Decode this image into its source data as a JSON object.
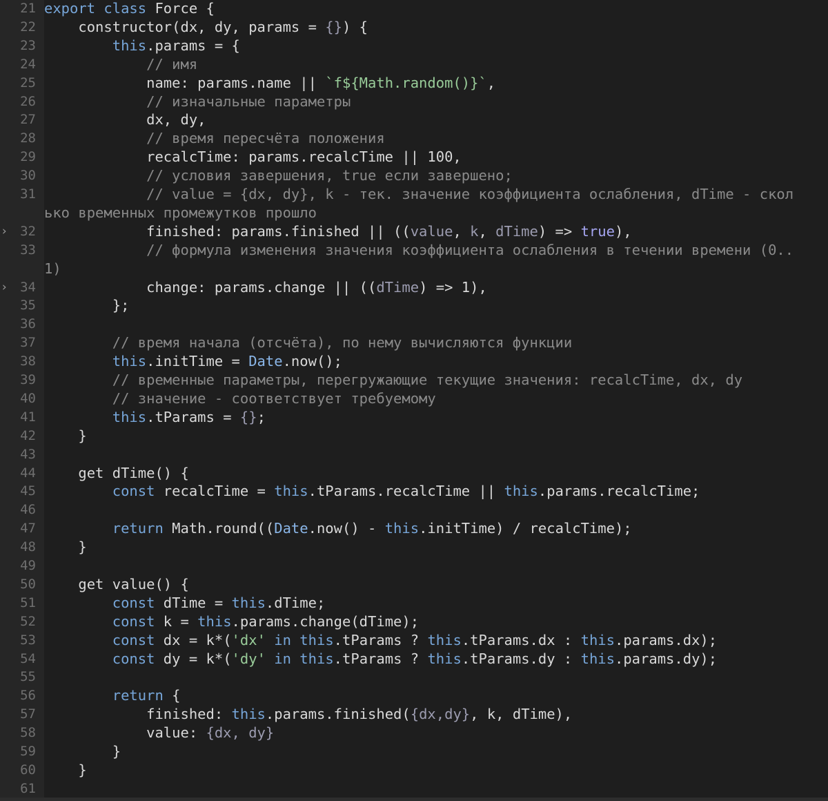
{
  "editor": {
    "theme_colors": {
      "background": "#1e1e1e",
      "gutter": "#262626",
      "comment": "#8a8a8a",
      "keyword": "#77a6d9",
      "string": "#99cc99",
      "text": "#d9d9d9"
    },
    "lines": [
      {
        "num": "21",
        "tokens": [
          [
            "kw",
            "export class "
          ],
          [
            "pl",
            "Force {"
          ]
        ]
      },
      {
        "num": "22",
        "tokens": [
          [
            "pl",
            "    constructor(dx, dy, params = "
          ],
          [
            "pr",
            "{}"
          ],
          [
            "pl",
            ") {"
          ]
        ]
      },
      {
        "num": "23",
        "tokens": [
          [
            "kw",
            "        this"
          ],
          [
            "pl",
            ".params = {"
          ]
        ]
      },
      {
        "num": "24",
        "tokens": [
          [
            "cm",
            "            // имя"
          ]
        ]
      },
      {
        "num": "25",
        "tokens": [
          [
            "pl",
            "            name: params.name || "
          ],
          [
            "str",
            "`f${Math.random()}`"
          ],
          [
            "pl",
            ","
          ]
        ]
      },
      {
        "num": "26",
        "tokens": [
          [
            "cm",
            "            // изначальные параметры"
          ]
        ]
      },
      {
        "num": "27",
        "tokens": [
          [
            "pl",
            "            dx, dy,"
          ]
        ]
      },
      {
        "num": "28",
        "tokens": [
          [
            "cm",
            "            // время пересчёта положения"
          ]
        ]
      },
      {
        "num": "29",
        "tokens": [
          [
            "pl",
            "            recalcTime: params.recalcTime || 100,"
          ]
        ]
      },
      {
        "num": "30",
        "tokens": [
          [
            "cm",
            "            // условия завершения, true если завершено;"
          ]
        ]
      },
      {
        "num": "31",
        "tokens": [
          [
            "cm",
            "            // value = {dx, dy}, k - тек. значение коэффициента ослабления, dTime - скол"
          ]
        ]
      },
      {
        "num": "",
        "tokens": [
          [
            "cm",
            "ько временных промежутков прошло"
          ]
        ]
      },
      {
        "num": "32",
        "fold": true,
        "tokens": [
          [
            "pl",
            "            finished: params.finished || (("
          ],
          [
            "pr",
            "value"
          ],
          [
            "pl",
            ", "
          ],
          [
            "pr",
            "k"
          ],
          [
            "pl",
            ", "
          ],
          [
            "pr",
            "dTime"
          ],
          [
            "pl",
            ") => "
          ],
          [
            "pu",
            "true"
          ],
          [
            "pl",
            "),"
          ]
        ]
      },
      {
        "num": "33",
        "tokens": [
          [
            "cm",
            "            // формула изменения значения коэффициента ослабления в течении времени (0.."
          ]
        ]
      },
      {
        "num": "",
        "tokens": [
          [
            "cm",
            "1)"
          ]
        ]
      },
      {
        "num": "34",
        "fold": true,
        "tokens": [
          [
            "pl",
            "            change: params.change || (("
          ],
          [
            "pr",
            "dTime"
          ],
          [
            "pl",
            ") => 1),"
          ]
        ]
      },
      {
        "num": "35",
        "tokens": [
          [
            "pl",
            "        };"
          ]
        ]
      },
      {
        "num": "36",
        "tokens": []
      },
      {
        "num": "37",
        "tokens": [
          [
            "cm",
            "        // время начала (отсчёта), по нему вычисляются функции"
          ]
        ]
      },
      {
        "num": "38",
        "tokens": [
          [
            "kw",
            "        this"
          ],
          [
            "pl",
            ".initTime = "
          ],
          [
            "ty",
            "Date"
          ],
          [
            "pl",
            ".now();"
          ]
        ]
      },
      {
        "num": "39",
        "tokens": [
          [
            "cm",
            "        // временные параметры, перегружающие текущие значения: recalcTime, dx, dy"
          ]
        ]
      },
      {
        "num": "40",
        "tokens": [
          [
            "cm",
            "        // значение - соответствует требуемому"
          ]
        ]
      },
      {
        "num": "41",
        "tokens": [
          [
            "kw",
            "        this"
          ],
          [
            "pl",
            ".tParams = "
          ],
          [
            "pr",
            "{}"
          ],
          [
            "pl",
            ";"
          ]
        ]
      },
      {
        "num": "42",
        "tokens": [
          [
            "pl",
            "    }"
          ]
        ]
      },
      {
        "num": "43",
        "tokens": []
      },
      {
        "num": "44",
        "tokens": [
          [
            "pl",
            "    get dTime() {"
          ]
        ]
      },
      {
        "num": "45",
        "tokens": [
          [
            "kw",
            "        const "
          ],
          [
            "pl",
            "recalcTime = "
          ],
          [
            "kw",
            "this"
          ],
          [
            "pl",
            ".tParams.recalcTime || "
          ],
          [
            "kw",
            "this"
          ],
          [
            "pl",
            ".params.recalcTime;"
          ]
        ]
      },
      {
        "num": "46",
        "tokens": []
      },
      {
        "num": "47",
        "tokens": [
          [
            "kw",
            "        return "
          ],
          [
            "pl",
            "Math.round(("
          ],
          [
            "ty",
            "Date"
          ],
          [
            "pl",
            ".now() - "
          ],
          [
            "kw",
            "this"
          ],
          [
            "pl",
            ".initTime) / recalcTime);"
          ]
        ]
      },
      {
        "num": "48",
        "tokens": [
          [
            "pl",
            "    }"
          ]
        ]
      },
      {
        "num": "49",
        "tokens": []
      },
      {
        "num": "50",
        "tokens": [
          [
            "pl",
            "    get value() {"
          ]
        ]
      },
      {
        "num": "51",
        "tokens": [
          [
            "kw",
            "        const "
          ],
          [
            "pl",
            "dTime = "
          ],
          [
            "kw",
            "this"
          ],
          [
            "pl",
            ".dTime;"
          ]
        ]
      },
      {
        "num": "52",
        "tokens": [
          [
            "kw",
            "        const "
          ],
          [
            "pl",
            "k = "
          ],
          [
            "kw",
            "this"
          ],
          [
            "pl",
            ".params.change(dTime);"
          ]
        ]
      },
      {
        "num": "53",
        "tokens": [
          [
            "kw",
            "        const "
          ],
          [
            "pl",
            "dx = k*("
          ],
          [
            "str",
            "'dx'"
          ],
          [
            "kw",
            " in this"
          ],
          [
            "pl",
            ".tParams ? "
          ],
          [
            "kw",
            "this"
          ],
          [
            "pl",
            ".tParams.dx : "
          ],
          [
            "kw",
            "this"
          ],
          [
            "pl",
            ".params.dx);"
          ]
        ]
      },
      {
        "num": "54",
        "tokens": [
          [
            "kw",
            "        const "
          ],
          [
            "pl",
            "dy = k*("
          ],
          [
            "str",
            "'dy'"
          ],
          [
            "kw",
            " in this"
          ],
          [
            "pl",
            ".tParams ? "
          ],
          [
            "kw",
            "this"
          ],
          [
            "pl",
            ".tParams.dy : "
          ],
          [
            "kw",
            "this"
          ],
          [
            "pl",
            ".params.dy);"
          ]
        ]
      },
      {
        "num": "55",
        "tokens": []
      },
      {
        "num": "56",
        "tokens": [
          [
            "kw",
            "        return "
          ],
          [
            "pl",
            "{"
          ]
        ]
      },
      {
        "num": "57",
        "tokens": [
          [
            "pl",
            "            finished: "
          ],
          [
            "kw",
            "this"
          ],
          [
            "pl",
            ".params.finished("
          ],
          [
            "pr",
            "{dx,dy}"
          ],
          [
            "pl",
            ", k, dTime),"
          ]
        ]
      },
      {
        "num": "58",
        "tokens": [
          [
            "pl",
            "            value: "
          ],
          [
            "pr",
            "{dx, dy}"
          ]
        ]
      },
      {
        "num": "59",
        "tokens": [
          [
            "pl",
            "        }"
          ]
        ]
      },
      {
        "num": "60",
        "tokens": [
          [
            "pl",
            "    }"
          ]
        ]
      },
      {
        "num": "61",
        "tokens": []
      }
    ]
  }
}
